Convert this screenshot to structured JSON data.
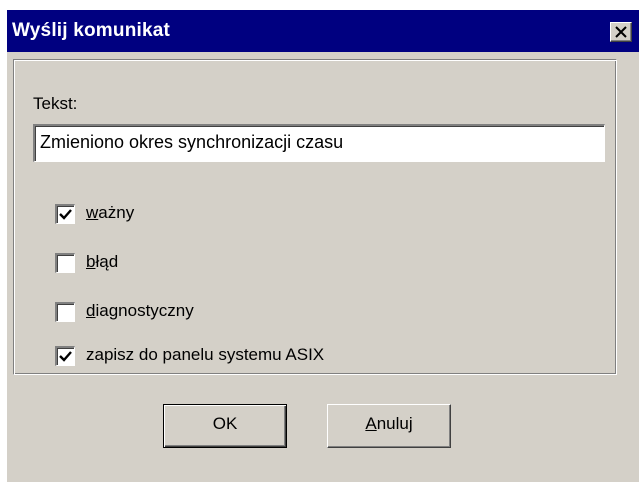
{
  "window": {
    "title": "Wyślij komunikat"
  },
  "form": {
    "text_label": "Tekst:",
    "text_value": "Zmieniono okres synchronizacji czasu",
    "checkboxes": [
      {
        "mnemonic": "w",
        "label_rest": "ażny",
        "checked": true
      },
      {
        "mnemonic": "b",
        "label_rest": "łąd",
        "checked": false
      },
      {
        "mnemonic": "d",
        "label_rest": "iagnostyczny",
        "checked": false
      },
      {
        "mnemonic": "",
        "label_rest": "zapisz do panelu systemu ASIX",
        "checked": true
      }
    ]
  },
  "buttons": {
    "ok_label": "OK",
    "cancel_mnemonic": "A",
    "cancel_rest": "nuluj"
  },
  "icons": {
    "close": "close-icon",
    "check": "checkmark-icon"
  }
}
